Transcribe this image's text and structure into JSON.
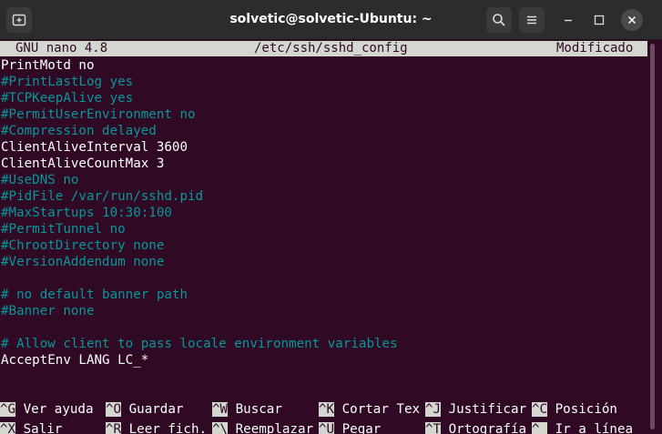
{
  "window": {
    "title": "solvetic@solvetic-Ubuntu: ~",
    "icons": [
      "new-tab-icon",
      "search-icon",
      "menu-icon",
      "minimize-icon",
      "maximize-icon",
      "close-icon"
    ]
  },
  "nano": {
    "version": "GNU nano 4.8",
    "file": "/etc/ssh/sshd_config",
    "status": "Modificado"
  },
  "lines": [
    "PrintMotd no",
    "#PrintLastLog yes",
    "#TCPKeepAlive yes",
    "#PermitUserEnvironment no",
    "#Compression delayed",
    "ClientAliveInterval 3600",
    "ClientAliveCountMax 3",
    "#UseDNS no",
    "#PidFile /var/run/sshd.pid",
    "#MaxStartups 10:30:100",
    "#PermitTunnel no",
    "#ChrootDirectory none",
    "#VersionAddendum none",
    "",
    "# no default banner path",
    "#Banner none",
    "",
    "# Allow client to pass locale environment variables",
    "AcceptEnv LANG LC_*"
  ],
  "shortcuts": [
    [
      {
        "key": "^G",
        "label": "Ver ayuda"
      },
      {
        "key": "^O",
        "label": "Guardar"
      },
      {
        "key": "^W",
        "label": "Buscar"
      },
      {
        "key": "^K",
        "label": "Cortar Tex"
      },
      {
        "key": "^J",
        "label": "Justificar"
      },
      {
        "key": "^C",
        "label": "Posición"
      }
    ],
    [
      {
        "key": "^X",
        "label": "Salir"
      },
      {
        "key": "^R",
        "label": "Leer fich."
      },
      {
        "key": "^\\",
        "label": "Reemplazar"
      },
      {
        "key": "^U",
        "label": "Pegar"
      },
      {
        "key": "^T",
        "label": "Ortografía"
      },
      {
        "key": "^_",
        "label": "Ir a línea"
      }
    ]
  ],
  "colors": {
    "terminal_bg": "#300a24",
    "comment": "#06989a",
    "text": "#ffffff",
    "header_bg": "#d3d7cf"
  }
}
